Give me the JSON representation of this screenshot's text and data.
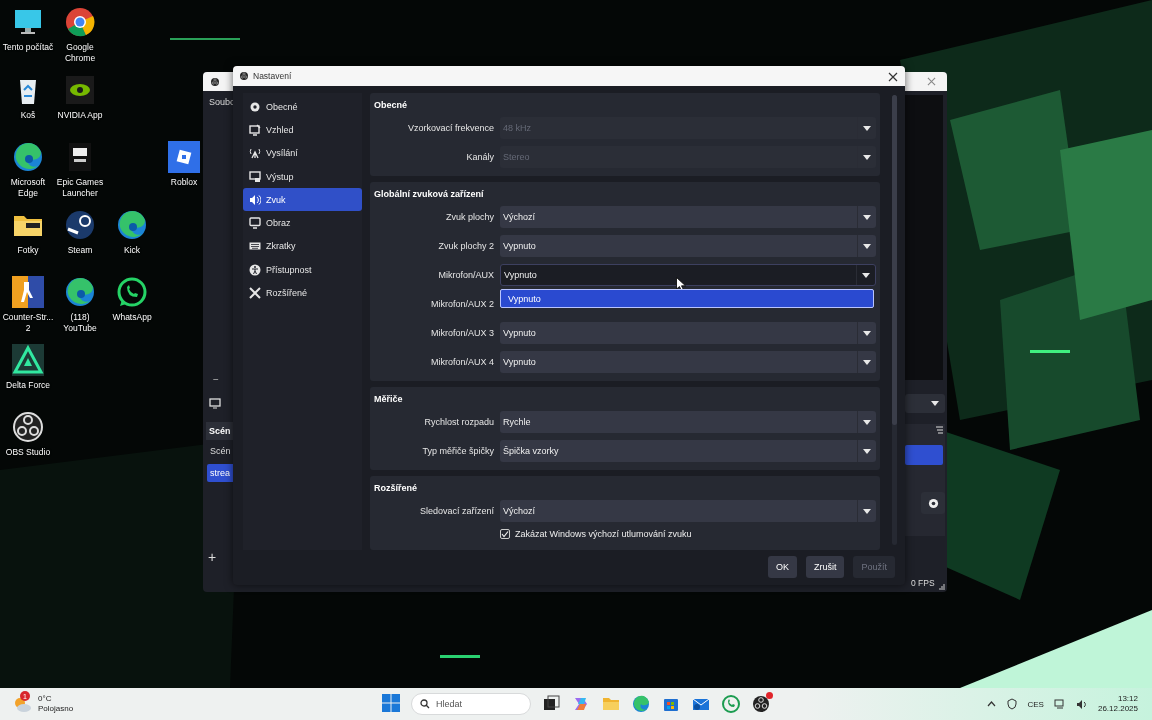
{
  "desktop": {
    "icons": [
      {
        "label": "Tento počítač",
        "kind": "monitor"
      },
      {
        "label": "Google Chrome",
        "kind": "chrome"
      },
      {
        "label": "Koš",
        "kind": "recycle"
      },
      {
        "label": "NVIDIA App",
        "kind": "nvidia"
      },
      {
        "label": "Microsoft Edge",
        "kind": "edge"
      },
      {
        "label": "Epic Games Launcher",
        "kind": "epic"
      },
      {
        "label": "Roblox",
        "kind": "roblox"
      },
      {
        "label": "Fotky",
        "kind": "folder"
      },
      {
        "label": "Steam",
        "kind": "steam"
      },
      {
        "label": "Kick",
        "kind": "edge"
      },
      {
        "label": "Counter-Str... 2",
        "kind": "soldier"
      },
      {
        "label": "(118) YouTube",
        "kind": "edge"
      },
      {
        "label": "WhatsApp",
        "kind": "whatsapp"
      },
      {
        "label": "Delta Force",
        "kind": "delta"
      },
      {
        "label": "OBS Studio",
        "kind": "obs"
      }
    ]
  },
  "obs_window": {
    "menu": "Soubo",
    "collapse_button": "−",
    "add_button": "+",
    "dock_header": "Scén",
    "scenes": [
      {
        "label": "Scén",
        "selected": false
      },
      {
        "label": "strea",
        "selected": true
      }
    ],
    "status": "0 FPS"
  },
  "settings": {
    "title": "Nastavení",
    "sidebar": [
      {
        "label": "Obecné",
        "kind": "gear",
        "selected": false
      },
      {
        "label": "Vzhled",
        "kind": "appearance",
        "selected": false
      },
      {
        "label": "Vysílání",
        "kind": "antenna",
        "selected": false
      },
      {
        "label": "Výstup",
        "kind": "output",
        "selected": false
      },
      {
        "label": "Zvuk",
        "kind": "audio",
        "selected": true
      },
      {
        "label": "Obraz",
        "kind": "video",
        "selected": false
      },
      {
        "label": "Zkratky",
        "kind": "keyboard",
        "selected": false
      },
      {
        "label": "Přístupnost",
        "kind": "accessibility",
        "selected": false
      },
      {
        "label": "Rozšířené",
        "kind": "tools",
        "selected": false
      }
    ],
    "sections": [
      {
        "title": "Obecné",
        "rows": [
          {
            "label": "Vzorkovací frekvence",
            "value": "48 kHz",
            "disabled": true,
            "open": false
          },
          {
            "label": "Kanály",
            "value": "Stereo",
            "disabled": true,
            "open": false
          }
        ]
      },
      {
        "title": "Globální zvuková zařízení",
        "rows": [
          {
            "label": "Zvuk plochy",
            "value": "Výchozí",
            "disabled": false,
            "open": false
          },
          {
            "label": "Zvuk plochy 2",
            "value": "Vypnuto",
            "disabled": false,
            "open": false
          },
          {
            "label": "Mikrofon/AUX",
            "value": "Vypnuto",
            "disabled": false,
            "open": true,
            "options": [
              {
                "label": "Vypnuto",
                "selected": true
              }
            ]
          },
          {
            "label": "Mikrofon/AUX 2"
          },
          {
            "label": "Mikrofon/AUX 3",
            "value": "Vypnuto",
            "disabled": false,
            "open": false
          },
          {
            "label": "Mikrofon/AUX 4",
            "value": "Vypnuto",
            "disabled": false,
            "open": false
          }
        ]
      },
      {
        "title": "Měřiče",
        "rows": [
          {
            "label": "Rychlost rozpadu",
            "value": "Rychle",
            "disabled": false,
            "open": false
          },
          {
            "label": "Typ měřiče špičky",
            "value": "Špička vzorky",
            "disabled": false,
            "open": false
          }
        ]
      },
      {
        "title": "Rozšířené",
        "rows": [
          {
            "label": "Sledovací zařízení",
            "value": "Výchozí",
            "disabled": false,
            "open": false
          }
        ],
        "checkboxes": [
          {
            "label": "Zakázat Windows výchozí utlumování zvuku",
            "checked": true
          }
        ]
      }
    ],
    "buttons": [
      {
        "label": "OK",
        "disabled": false
      },
      {
        "label": "Zrušit",
        "disabled": false
      },
      {
        "label": "Použít",
        "disabled": true
      }
    ]
  },
  "taskbar": {
    "weather": {
      "temperature": "0°C",
      "condition": "Polojasno",
      "badge": "1"
    },
    "search": {
      "placeholder": "Hledat"
    },
    "apps": [
      {
        "kind": "task-view",
        "notification": false
      },
      {
        "kind": "copilot",
        "notification": false
      },
      {
        "kind": "folder",
        "notification": false
      },
      {
        "kind": "edge",
        "notification": false
      },
      {
        "kind": "store",
        "notification": false
      },
      {
        "kind": "mail",
        "notification": false
      },
      {
        "kind": "whatsapp",
        "notification": false
      },
      {
        "kind": "obs",
        "notification": true
      }
    ],
    "tray": {
      "language": "CES",
      "time": "13:12",
      "date": "26.12.2025"
    }
  }
}
